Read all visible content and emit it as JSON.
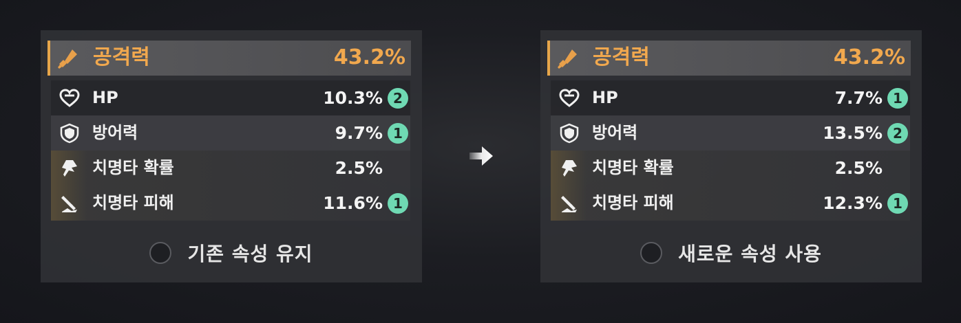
{
  "left_panel": {
    "main_stat": {
      "icon": "sword-icon",
      "label": "공격력",
      "value": "43.2%"
    },
    "sub_stats": [
      {
        "icon": "heart-icon",
        "label": "HP",
        "value": "10.3%",
        "badge": "2"
      },
      {
        "icon": "shield-icon",
        "label": "방어력",
        "value": "9.7%",
        "badge": "1"
      },
      {
        "icon": "crit-rate-icon",
        "label": "치명타 확률",
        "value": "2.5%",
        "badge": ""
      },
      {
        "icon": "crit-damage-icon",
        "label": "치명타 피해",
        "value": "11.6%",
        "badge": "1"
      }
    ],
    "option_label": "기존 속성 유지",
    "option_selected": false
  },
  "right_panel": {
    "main_stat": {
      "icon": "sword-icon",
      "label": "공격력",
      "value": "43.2%"
    },
    "sub_stats": [
      {
        "icon": "heart-icon",
        "label": "HP",
        "value": "7.7%",
        "badge": "1"
      },
      {
        "icon": "shield-icon",
        "label": "방어력",
        "value": "13.5%",
        "badge": "2"
      },
      {
        "icon": "crit-rate-icon",
        "label": "치명타 확률",
        "value": "2.5%",
        "badge": ""
      },
      {
        "icon": "crit-damage-icon",
        "label": "치명타 피해",
        "value": "12.3%",
        "badge": "1"
      }
    ],
    "option_label": "새로운 속성 사용",
    "option_selected": false
  },
  "colors": {
    "accent": "#f1a84e",
    "badge": "#6fd9b3",
    "panel": "#303135"
  },
  "arrow_icon": "arrow-right-icon"
}
